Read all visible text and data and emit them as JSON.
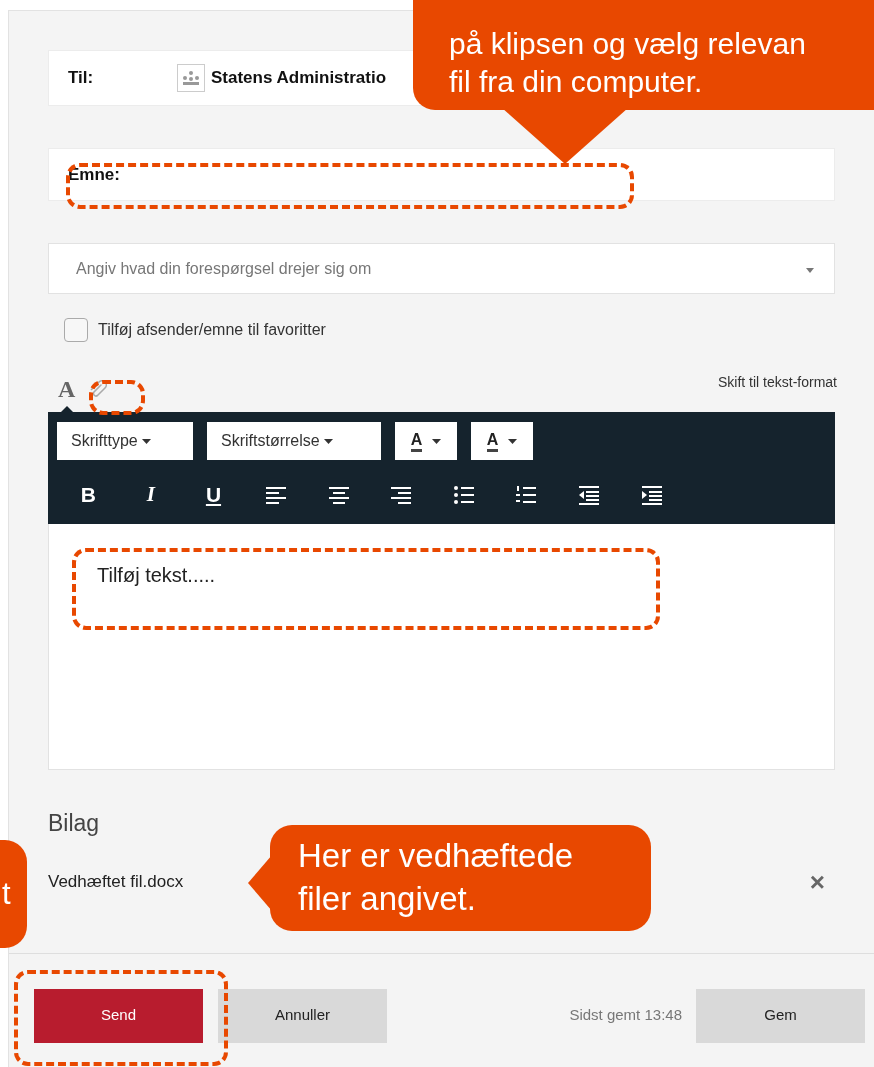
{
  "recipient": {
    "label": "Til:",
    "name": "Statens Administratio"
  },
  "subject": {
    "label": "Emne:"
  },
  "topic_select": {
    "placeholder": "Angiv hvad din forespørgsel drejer sig om"
  },
  "favorite_checkbox": {
    "label": "Tilføj afsender/emne til favoritter",
    "checked": false
  },
  "editor_tabs": [
    {
      "kind": "text",
      "label": "A",
      "selected": true
    },
    {
      "kind": "attach",
      "selected": false
    }
  ],
  "switch_link": "Skift til tekst-format",
  "toolbar": {
    "dropdowns": [
      {
        "kind": "menu",
        "label": "Skrifttype"
      },
      {
        "kind": "menu",
        "label": "Skriftstørrelse"
      },
      {
        "kind": "color",
        "label": "A"
      },
      {
        "kind": "color",
        "label": "A"
      }
    ],
    "buttons": [
      {
        "kind": "bold",
        "label": "B"
      },
      {
        "kind": "italic",
        "label": "I"
      },
      {
        "kind": "underline",
        "label": "U"
      },
      {
        "kind": "align-left"
      },
      {
        "kind": "align-center"
      },
      {
        "kind": "align-right"
      },
      {
        "kind": "bullets"
      },
      {
        "kind": "numbers"
      },
      {
        "kind": "outdent"
      },
      {
        "kind": "indent"
      }
    ]
  },
  "editor": {
    "value": "Tilføj tekst....."
  },
  "attachments": {
    "title": "Bilag",
    "files": [
      {
        "name": "Vedhæftet fil.docx",
        "remove": "×"
      }
    ]
  },
  "footer": {
    "buttons": [
      {
        "kind": "primary",
        "label": "Send"
      },
      {
        "kind": "secondary",
        "label": "Annuller"
      }
    ],
    "saved": "Sidst gemt 13:48",
    "save": "Gem"
  },
  "callouts": [
    {
      "kind": "down",
      "lines": [
        "på klipsen og vælg relevan",
        "fil fra din computer."
      ]
    },
    {
      "kind": "plain",
      "lines": [
        "t"
      ]
    },
    {
      "kind": "left",
      "lines": [
        "Her er vedhæftede",
        "filer angivet."
      ]
    }
  ]
}
